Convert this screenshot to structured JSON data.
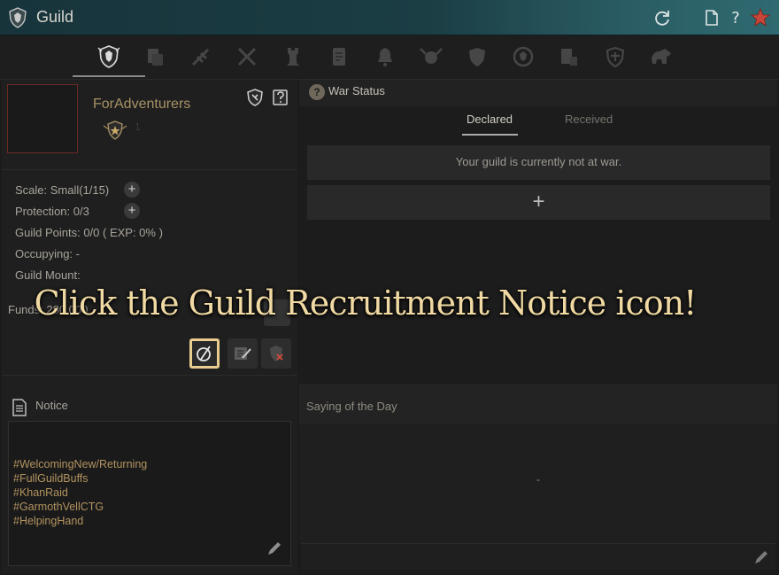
{
  "window": {
    "title": "Guild",
    "icons": [
      "guild-crest-icon",
      "refresh-icon",
      "document-icon",
      "help-icon",
      "close-star-icon"
    ]
  },
  "tabs": [
    {
      "name": "guild-info",
      "icon": "crest-icon",
      "active": true
    },
    {
      "name": "members",
      "icon": "members-icon"
    },
    {
      "name": "skills",
      "icon": "quill-icon"
    },
    {
      "name": "war",
      "icon": "crossed-swords-icon"
    },
    {
      "name": "node-war",
      "icon": "tower-icon"
    },
    {
      "name": "quests",
      "icon": "scroll-icon"
    },
    {
      "name": "notifications",
      "icon": "bell-icon"
    },
    {
      "name": "alliance",
      "icon": "horned-crest-icon"
    },
    {
      "name": "defense",
      "icon": "shield-icon"
    },
    {
      "name": "league",
      "icon": "laurel-icon"
    },
    {
      "name": "house",
      "icon": "house-icon"
    },
    {
      "name": "protection",
      "icon": "shield-cross-icon"
    },
    {
      "name": "mount",
      "icon": "mount-icon"
    }
  ],
  "guild": {
    "name": "ForAdventurers",
    "rank_number": "1",
    "scale": "Scale: Small(1/15)",
    "protection": "Protection: 0/3",
    "points": "Guild Points: 0/0 ( EXP: 0% )",
    "occupying": "Occupying: -",
    "mount": "Guild Mount:",
    "funds": "Funds: 280,000"
  },
  "notice": {
    "title": "Notice",
    "lines": [
      "#WelcomingNew/Returning",
      "#FullGuildBuffs",
      "#KhanRaid",
      "#GarmothVellCTG",
      "#HelpingHand"
    ]
  },
  "war": {
    "title": "War Status",
    "tabs": [
      "Declared",
      "Received"
    ],
    "active_tab": "Declared",
    "status_text": "Your guild is currently not at war.",
    "add_symbol": "+"
  },
  "saying": {
    "title": "Saying of the Day",
    "content": "-"
  },
  "overlay": {
    "instruction": "Click the Guild Recruitment Notice icon!"
  },
  "colors": {
    "accent_gold": "#e9cd8e",
    "name_gold": "#a89264",
    "hashtag_gold": "#b3935e",
    "titlebar_teal": "#1b3d44"
  }
}
